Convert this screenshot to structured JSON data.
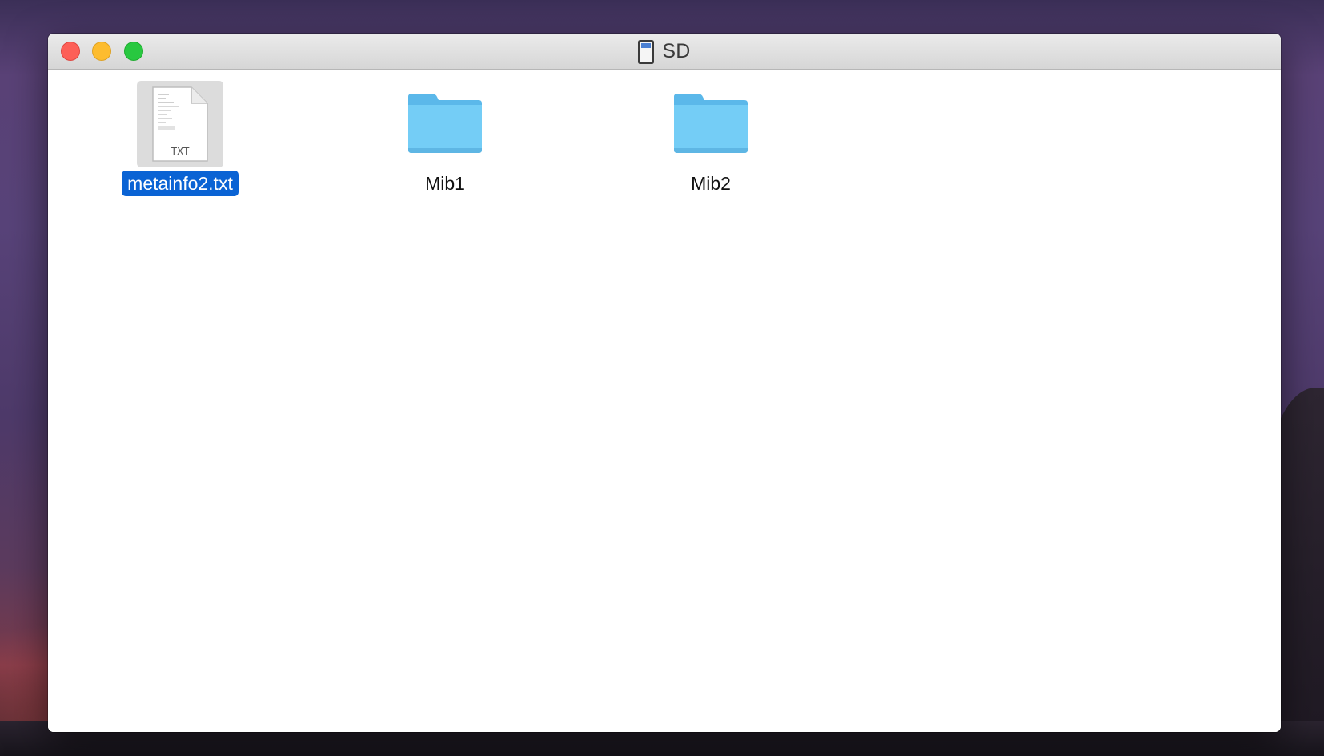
{
  "window": {
    "title": "SD",
    "title_icon": "sd-card-icon"
  },
  "traffic_lights": {
    "close_color": "#fd5f57",
    "minimize_color": "#fdbc2e",
    "maximize_color": "#28c840"
  },
  "files": [
    {
      "name": "metainfo2.txt",
      "kind": "text-file",
      "badge": "TXT",
      "selected": true
    },
    {
      "name": "Mib1",
      "kind": "folder",
      "selected": false
    },
    {
      "name": "Mib2",
      "kind": "folder",
      "selected": false
    }
  ],
  "colors": {
    "selection": "#0a63d4",
    "folder": "#6cc6f3"
  }
}
